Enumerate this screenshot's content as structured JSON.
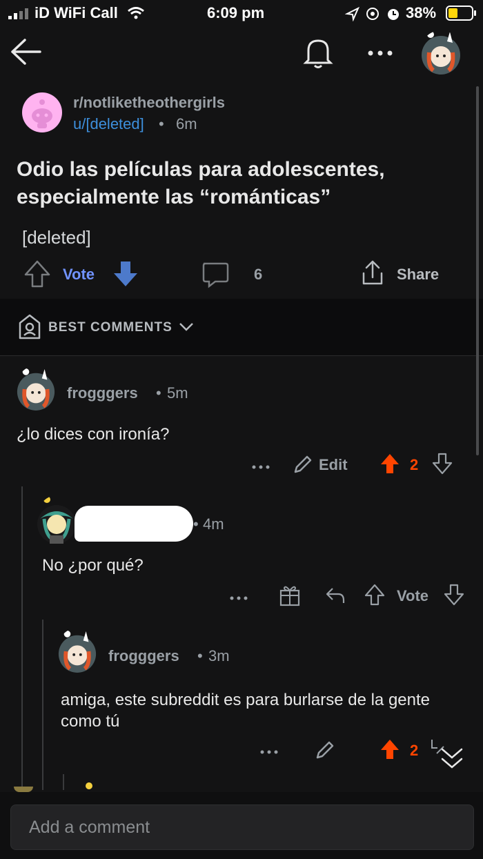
{
  "status_bar": {
    "carrier": "iD WiFi Call",
    "time": "6:09 pm",
    "battery": "38%"
  },
  "post": {
    "subreddit": "r/notliketheothergirls",
    "author": "u/[deleted]",
    "age": "6m",
    "title": "Odio las películas para adolescentes, especialmente las “románticas”",
    "body": "[deleted]",
    "vote_label": "Vote",
    "comment_count": "6",
    "share_label": "Share"
  },
  "sort": {
    "label": "BEST COMMENTS"
  },
  "comments": [
    {
      "user": "frogggers",
      "age": "5m",
      "text": "¿lo dices con ironía?",
      "edit_label": "Edit",
      "score": "2"
    },
    {
      "user": "",
      "age": "4m",
      "text": "No ¿por qué?",
      "vote_label": "Vote"
    },
    {
      "user": "frogggers",
      "age": "3m",
      "text": "amiga, este subreddit es para burlarse de la gente como tú",
      "score": "2"
    }
  ],
  "composer": {
    "placeholder": "Add a comment"
  },
  "colors": {
    "accent_orange": "#ff4500",
    "link_blue": "#3d8fdc",
    "vote_blue": "#7193ff",
    "downvote_blue": "#4d7acb"
  },
  "icons": [
    "back-icon",
    "bell-icon",
    "more-icon",
    "upvote-icon",
    "downvote-icon",
    "comment-icon",
    "share-icon",
    "shield-icon",
    "chevron-down-icon",
    "pencil-icon",
    "gift-icon",
    "reply-icon"
  ]
}
